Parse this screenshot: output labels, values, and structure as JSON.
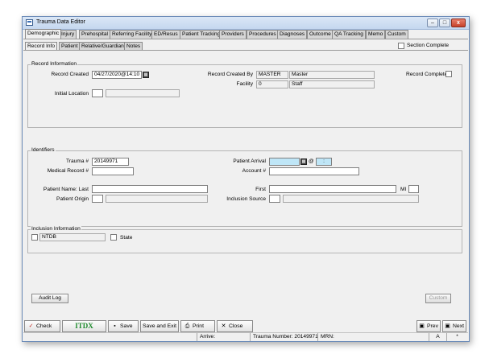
{
  "window": {
    "title": "Trauma Data Editor",
    "minimize": "–",
    "maximize": "□",
    "close": "x"
  },
  "main_tabs": [
    "Demographic",
    "Injury",
    "Prehospital",
    "Referring Facility",
    "ED/Resus",
    "Patient Tracking",
    "Providers",
    "Procedures",
    "Diagnoses",
    "Outcome",
    "QA Tracking",
    "Memo",
    "Custom"
  ],
  "sub_tabs": [
    "Record Info",
    "Patient",
    "Relative/Guardian",
    "Notes"
  ],
  "section_complete_label": "Section Complete",
  "record_info": {
    "group_label": "Record Information",
    "record_created_label": "Record Created",
    "record_created_value": "04/27/2020@14:10",
    "record_created_by_label": "Record Created By",
    "record_created_by_code": "MASTER",
    "record_created_by_name": "Master",
    "facility_label": "Facility",
    "facility_code": "0",
    "facility_name": "Staff",
    "record_complete_label": "Record Complete",
    "initial_location_label": "Initial Location"
  },
  "identifiers": {
    "group_label": "Identifiers",
    "trauma_label": "Trauma #",
    "trauma_value": "20149971",
    "medical_record_label": "Medical Record #",
    "patient_arrival_label": "Patient Arrival",
    "at_sign": "@",
    "time_sep": ":",
    "account_label": "Account #",
    "patient_name_label": "Patient Name: Last",
    "first_label": "First",
    "mi_label": "MI",
    "patient_origin_label": "Patient Origin",
    "inclusion_source_label": "Inclusion Source"
  },
  "inclusion": {
    "group_label": "Inclusion Information",
    "ntdb_value": "NTDB",
    "state_label": "State"
  },
  "buttons": {
    "audit_log": "Audit Log",
    "custom": "Custom"
  },
  "toolbar": {
    "check": "Check",
    "itdx": "ITDX",
    "save": "Save",
    "save_exit": "Save and Exit",
    "print": "Print",
    "close": "Close",
    "prev": "Prev",
    "next": "Next"
  },
  "statusbar": {
    "arrive": "Arrive:",
    "trauma_number": "Trauma Number: 20149971",
    "mrn": "MRN:",
    "a": "A",
    "star": "*"
  },
  "colors": {
    "arrival_field": "#bfe6f7",
    "itdx_green": "#1d8a2c",
    "check_red": "#c0281e"
  }
}
